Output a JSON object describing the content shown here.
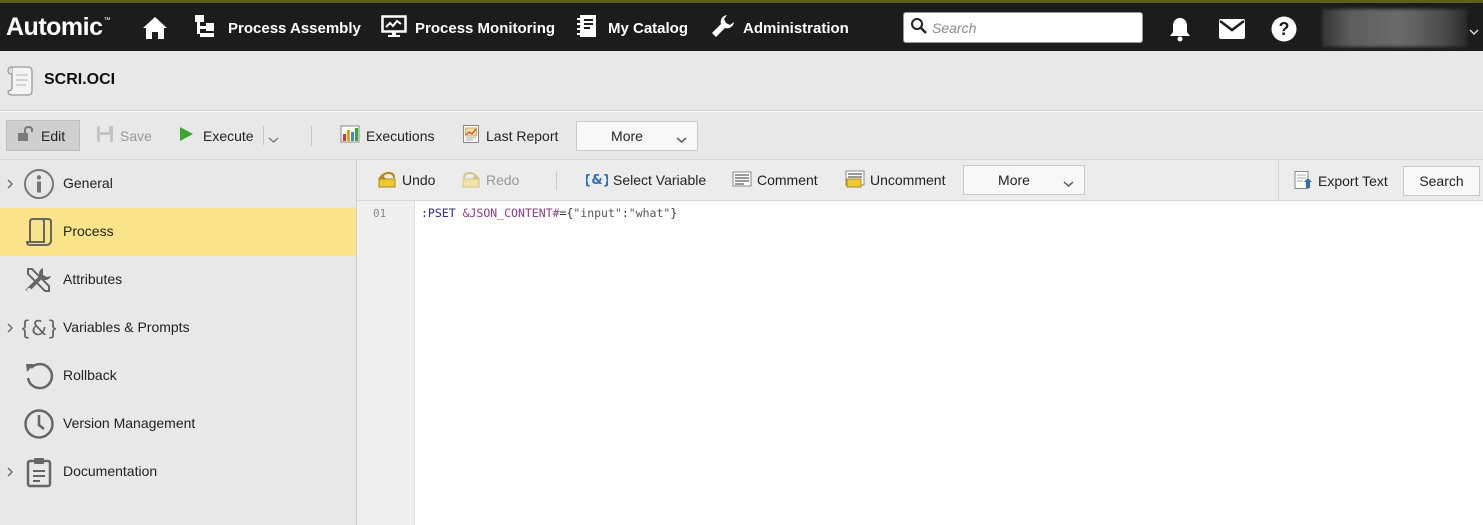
{
  "app": {
    "logo": "Automic",
    "logo_mark": "™"
  },
  "topnav": {
    "items": [
      {
        "label": "Process Assembly",
        "icon": "process-assembly-icon"
      },
      {
        "label": "Process Monitoring",
        "icon": "monitor-icon"
      },
      {
        "label": "My Catalog",
        "icon": "catalog-icon"
      },
      {
        "label": "Administration",
        "icon": "wrench-icon"
      }
    ],
    "search_placeholder": "Search",
    "icons": [
      "home-icon",
      "bell-icon",
      "mail-icon",
      "help-icon"
    ]
  },
  "object": {
    "title": "SCRI.OCI",
    "icon": "script-icon"
  },
  "toolbar": {
    "edit_label": "Edit",
    "save_label": "Save",
    "execute_label": "Execute",
    "executions_label": "Executions",
    "last_report_label": "Last Report",
    "more_label": "More"
  },
  "sidebar": {
    "items": [
      {
        "label": "General",
        "icon": "info-icon",
        "expandable": true,
        "active": false
      },
      {
        "label": "Process",
        "icon": "script-icon",
        "expandable": false,
        "active": true
      },
      {
        "label": "Attributes",
        "icon": "tools-icon",
        "expandable": false,
        "active": false
      },
      {
        "label": "Variables & Prompts",
        "icon": "variable-icon",
        "expandable": true,
        "active": false
      },
      {
        "label": "Rollback",
        "icon": "rollback-icon",
        "expandable": false,
        "active": false
      },
      {
        "label": "Version Management",
        "icon": "clock-icon",
        "expandable": false,
        "active": false
      },
      {
        "label": "Documentation",
        "icon": "clipboard-icon",
        "expandable": true,
        "active": false
      }
    ]
  },
  "editor_toolbar": {
    "undo_label": "Undo",
    "redo_label": "Redo",
    "select_variable_label": "Select Variable",
    "comment_label": "Comment",
    "uncomment_label": "Uncomment",
    "more_label": "More",
    "export_text_label": "Export Text",
    "search_label": "Search"
  },
  "editor": {
    "lines": [
      {
        "number": "01",
        "tokens": [
          {
            "type": "kw",
            "text": ":PSET"
          },
          {
            "type": "op",
            "text": " "
          },
          {
            "type": "var",
            "text": "&JSON_CONTENT#"
          },
          {
            "type": "op",
            "text": "={"
          },
          {
            "type": "str",
            "text": "\"input\""
          },
          {
            "type": "op",
            "text": ":"
          },
          {
            "type": "str",
            "text": "\"what\""
          },
          {
            "type": "op",
            "text": "}"
          }
        ]
      }
    ]
  },
  "colors": {
    "topbar_bg": "#1c1c1c",
    "active_item_bg": "#f9e489",
    "panel_bg": "#e8e8e8"
  }
}
